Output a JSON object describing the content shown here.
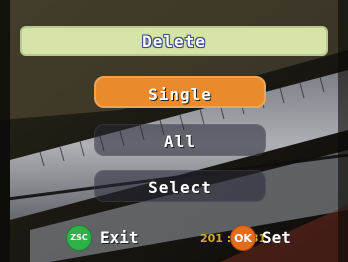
{
  "header": {
    "title": "Delete"
  },
  "menu": {
    "items": [
      {
        "label": "Single",
        "selected": true
      },
      {
        "label": "All",
        "selected": false
      },
      {
        "label": "Select",
        "selected": false
      }
    ]
  },
  "footer": {
    "exit_button_icon_text": "ZSC",
    "exit_label": "Exit",
    "ok_button_icon_text": "OK",
    "set_label": "Set",
    "timestamp_overlay": "201 :55:31"
  },
  "colors": {
    "header_bar": "#d6e4a8",
    "selected_item": "#e98b2c",
    "zsc_button": "#2fb14a",
    "ok_button": "#e46b1a",
    "timestamp": "#f3c534"
  }
}
